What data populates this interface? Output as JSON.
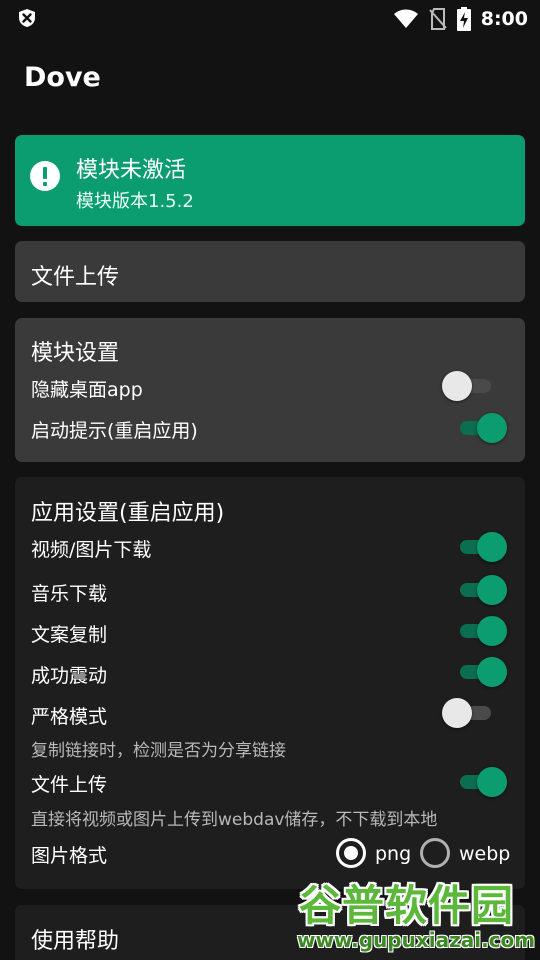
{
  "status_bar": {
    "time": "8:00",
    "left_icon": "shield-x-icon",
    "icons": [
      "wifi-icon",
      "no-sim-icon",
      "battery-charging-icon"
    ]
  },
  "app": {
    "title": "Dove"
  },
  "status_card": {
    "icon": "alert-circle-icon",
    "title": "模块未激活",
    "subtitle": "模块版本1.5.2",
    "color": "#0b9d70"
  },
  "upload_card": {
    "label": "文件上传"
  },
  "module_settings": {
    "title": "模块设置",
    "items": [
      {
        "label": "隐藏桌面app",
        "enabled": false
      },
      {
        "label": "启动提示(重启应用)",
        "enabled": true
      }
    ]
  },
  "app_settings": {
    "title": "应用设置(重启应用)",
    "items": [
      {
        "label": "视频/图片下载",
        "enabled": true
      },
      {
        "label": "音乐下载",
        "enabled": true
      },
      {
        "label": "文案复制",
        "enabled": true
      },
      {
        "label": "成功震动",
        "enabled": true
      },
      {
        "label": "严格模式",
        "enabled": false,
        "hint": "复制链接时，检测是否为分享链接"
      },
      {
        "label": "文件上传",
        "enabled": true,
        "hint": "直接将视频或图片上传到webdav储存，不下载到本地"
      }
    ],
    "image_format": {
      "label": "图片格式",
      "options": [
        "png",
        "webp"
      ],
      "selected": "png"
    }
  },
  "help_card": {
    "label": "使用帮助"
  },
  "watermark": {
    "title": "谷普软件园",
    "url": "www.gupuxiazai.com"
  },
  "colors": {
    "accent": "#0b9d70",
    "background": "#121212",
    "card_dark": "#3a3a3a",
    "card_darker": "#1e1e1e"
  }
}
